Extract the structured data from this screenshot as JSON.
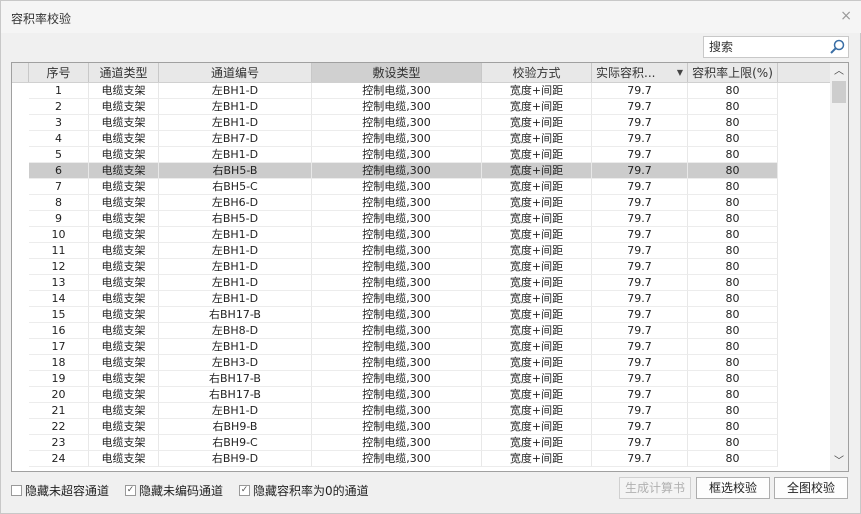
{
  "window": {
    "title": "容积率校验",
    "close": "×"
  },
  "search": {
    "placeholder": "搜索",
    "value": ""
  },
  "columns": [
    "序号",
    "通道类型",
    "通道编号",
    "敷设类型",
    "校验方式",
    "实际容积...",
    "容积率上限(%)"
  ],
  "selected_row": 6,
  "rows": [
    [
      "1",
      "电缆支架",
      "左BH1-D",
      "控制电缆,300",
      "宽度+间距",
      "79.7",
      "80"
    ],
    [
      "2",
      "电缆支架",
      "左BH1-D",
      "控制电缆,300",
      "宽度+间距",
      "79.7",
      "80"
    ],
    [
      "3",
      "电缆支架",
      "左BH1-D",
      "控制电缆,300",
      "宽度+间距",
      "79.7",
      "80"
    ],
    [
      "4",
      "电缆支架",
      "左BH7-D",
      "控制电缆,300",
      "宽度+间距",
      "79.7",
      "80"
    ],
    [
      "5",
      "电缆支架",
      "左BH1-D",
      "控制电缆,300",
      "宽度+间距",
      "79.7",
      "80"
    ],
    [
      "6",
      "电缆支架",
      "右BH5-B",
      "控制电缆,300",
      "宽度+间距",
      "79.7",
      "80"
    ],
    [
      "7",
      "电缆支架",
      "右BH5-C",
      "控制电缆,300",
      "宽度+间距",
      "79.7",
      "80"
    ],
    [
      "8",
      "电缆支架",
      "左BH6-D",
      "控制电缆,300",
      "宽度+间距",
      "79.7",
      "80"
    ],
    [
      "9",
      "电缆支架",
      "右BH5-D",
      "控制电缆,300",
      "宽度+间距",
      "79.7",
      "80"
    ],
    [
      "10",
      "电缆支架",
      "左BH1-D",
      "控制电缆,300",
      "宽度+间距",
      "79.7",
      "80"
    ],
    [
      "11",
      "电缆支架",
      "左BH1-D",
      "控制电缆,300",
      "宽度+间距",
      "79.7",
      "80"
    ],
    [
      "12",
      "电缆支架",
      "左BH1-D",
      "控制电缆,300",
      "宽度+间距",
      "79.7",
      "80"
    ],
    [
      "13",
      "电缆支架",
      "左BH1-D",
      "控制电缆,300",
      "宽度+间距",
      "79.7",
      "80"
    ],
    [
      "14",
      "电缆支架",
      "左BH1-D",
      "控制电缆,300",
      "宽度+间距",
      "79.7",
      "80"
    ],
    [
      "15",
      "电缆支架",
      "右BH17-B",
      "控制电缆,300",
      "宽度+间距",
      "79.7",
      "80"
    ],
    [
      "16",
      "电缆支架",
      "左BH8-D",
      "控制电缆,300",
      "宽度+间距",
      "79.7",
      "80"
    ],
    [
      "17",
      "电缆支架",
      "左BH1-D",
      "控制电缆,300",
      "宽度+间距",
      "79.7",
      "80"
    ],
    [
      "18",
      "电缆支架",
      "左BH3-D",
      "控制电缆,300",
      "宽度+间距",
      "79.7",
      "80"
    ],
    [
      "19",
      "电缆支架",
      "右BH17-B",
      "控制电缆,300",
      "宽度+间距",
      "79.7",
      "80"
    ],
    [
      "20",
      "电缆支架",
      "右BH17-B",
      "控制电缆,300",
      "宽度+间距",
      "79.7",
      "80"
    ],
    [
      "21",
      "电缆支架",
      "左BH1-D",
      "控制电缆,300",
      "宽度+间距",
      "79.7",
      "80"
    ],
    [
      "22",
      "电缆支架",
      "右BH9-B",
      "控制电缆,300",
      "宽度+间距",
      "79.7",
      "80"
    ],
    [
      "23",
      "电缆支架",
      "右BH9-C",
      "控制电缆,300",
      "宽度+间距",
      "79.7",
      "80"
    ],
    [
      "24",
      "电缆支架",
      "右BH9-D",
      "控制电缆,300",
      "宽度+间距",
      "79.7",
      "80"
    ]
  ],
  "options": [
    {
      "label": "隐藏未超容通道",
      "checked": false
    },
    {
      "label": "隐藏未编码通道",
      "checked": true
    },
    {
      "label": "隐藏容积率为0的通道",
      "checked": true
    }
  ],
  "buttons": {
    "generate": "生成计算书",
    "box_check": "框选校验",
    "full_check": "全图校验"
  }
}
